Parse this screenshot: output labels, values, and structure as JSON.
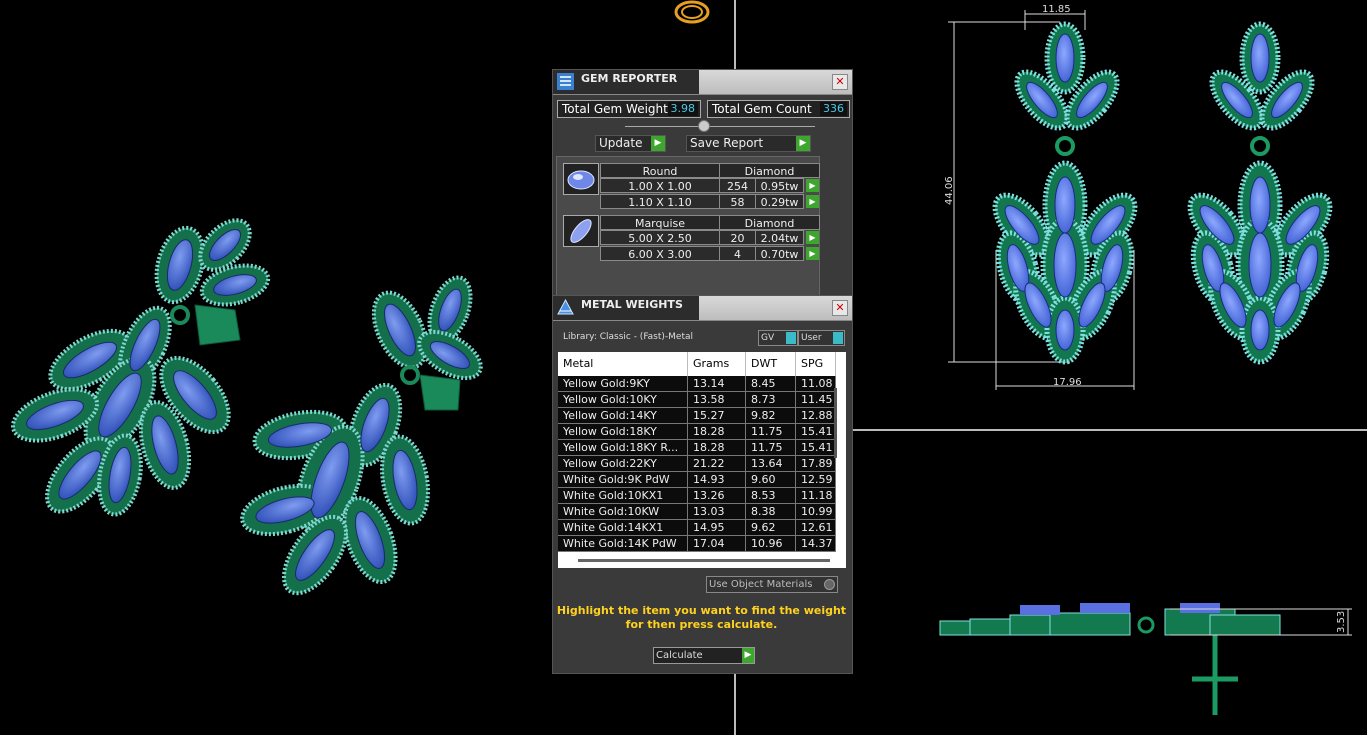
{
  "gem_reporter": {
    "title": "GEM REPORTER",
    "total_gem_weight_label": "Total Gem Weight",
    "total_gem_weight_value": "3.98",
    "total_gem_count_label": "Total Gem Count",
    "total_gem_count_value": "336",
    "update_label": "Update",
    "save_report_label": "Save Report",
    "groups": [
      {
        "shape": "Round",
        "material": "Diamond",
        "rows": [
          {
            "size": "1.00 X 1.00",
            "count": "254",
            "weight": "0.95tw"
          },
          {
            "size": "1.10 X 1.10",
            "count": "58",
            "weight": "0.29tw"
          }
        ]
      },
      {
        "shape": "Marquise",
        "material": "Diamond",
        "rows": [
          {
            "size": "5.00 X 2.50",
            "count": "20",
            "weight": "2.04tw"
          },
          {
            "size": "6.00 X 3.00",
            "count": "4",
            "weight": "0.70tw"
          }
        ]
      }
    ]
  },
  "metal_weights": {
    "title": "METAL WEIGHTS",
    "library_text": "Library: Classic - (Fast)-Metal",
    "toggle_gv": "GV",
    "toggle_user": "User",
    "columns": [
      "Metal",
      "Grams",
      "DWT",
      "SPG"
    ],
    "rows": [
      [
        "Yellow Gold:9KY",
        "13.14",
        "8.45",
        "11.08"
      ],
      [
        "Yellow Gold:10KY",
        "13.58",
        "8.73",
        "11.45"
      ],
      [
        "Yellow Gold:14KY",
        "15.27",
        "9.82",
        "12.88"
      ],
      [
        "Yellow Gold:18KY",
        "18.28",
        "11.75",
        "15.41"
      ],
      [
        "Yellow Gold:18KY R...",
        "18.28",
        "11.75",
        "15.41"
      ],
      [
        "Yellow Gold:22KY",
        "21.22",
        "13.64",
        "17.89"
      ],
      [
        "White Gold:9K PdW",
        "14.93",
        "9.60",
        "12.59"
      ],
      [
        "White Gold:10KX1",
        "13.26",
        "8.53",
        "11.18"
      ],
      [
        "White Gold:10KW",
        "13.03",
        "8.38",
        "10.99"
      ],
      [
        "White Gold:14KX1",
        "14.95",
        "9.62",
        "12.61"
      ],
      [
        "White Gold:14K PdW",
        "17.04",
        "10.96",
        "14.37"
      ]
    ],
    "use_object_materials": "Use Object Materials",
    "hint_line1": "Highlight the item you want to find the weight",
    "hint_line2": "for then press calculate.",
    "calculate_label": "Calculate"
  },
  "dimensions": {
    "top_width": "11.85",
    "height": "44.06",
    "bottom_width": "17.96",
    "side_depth": "3.53"
  }
}
